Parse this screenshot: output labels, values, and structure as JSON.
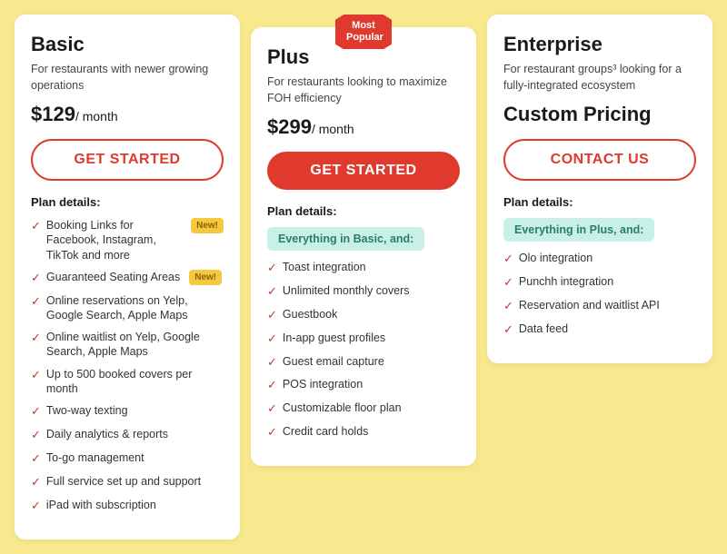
{
  "cards": [
    {
      "id": "basic",
      "title": "Basic",
      "subtitle": "For restaurants with newer growing operations",
      "price": "$129",
      "price_period": "/ month",
      "button_label": "GET STARTED",
      "button_style": "outline",
      "plan_details_label": "Plan details:",
      "most_popular": false,
      "everything_in": null,
      "features": [
        {
          "text": "Booking Links for Facebook, Instagram, TikTok and more",
          "badge": "New!"
        },
        {
          "text": "Guaranteed Seating Areas",
          "badge": "New!"
        },
        {
          "text": "Online reservations on Yelp, Google Search, Apple Maps"
        },
        {
          "text": "Online waitlist on Yelp, Google Search, Apple Maps"
        },
        {
          "text": "Up to 500 booked covers per month"
        },
        {
          "text": "Two-way texting"
        },
        {
          "text": "Daily analytics & reports"
        },
        {
          "text": "To-go management"
        },
        {
          "text": "Full service set up and support"
        },
        {
          "text": "iPad with subscription"
        }
      ]
    },
    {
      "id": "plus",
      "title": "Plus",
      "subtitle": "For restaurants looking to maximize FOH efficiency",
      "price": "$299",
      "price_period": "/ month",
      "button_label": "GET STARTED",
      "button_style": "filled",
      "plan_details_label": "Plan details:",
      "most_popular": true,
      "most_popular_text": "Most\nPopular",
      "everything_in": "Everything in Basic, and:",
      "features": [
        {
          "text": "Toast integration"
        },
        {
          "text": "Unlimited monthly covers"
        },
        {
          "text": "Guestbook"
        },
        {
          "text": "In-app guest profiles"
        },
        {
          "text": "Guest email capture"
        },
        {
          "text": "POS integration"
        },
        {
          "text": "Customizable floor plan"
        },
        {
          "text": "Credit card holds"
        }
      ]
    },
    {
      "id": "enterprise",
      "title": "Enterprise",
      "subtitle": "For restaurant groups³ looking for a fully-integrated ecosystem",
      "price": "Custom Pricing",
      "price_period": "",
      "button_label": "CONTACT US",
      "button_style": "outline",
      "plan_details_label": "Plan details:",
      "most_popular": false,
      "everything_in": "Everything in Plus, and:",
      "features": [
        {
          "text": "Olo integration"
        },
        {
          "text": "Punchh integration"
        },
        {
          "text": "Reservation and waitlist API"
        },
        {
          "text": "Data feed"
        }
      ]
    }
  ]
}
